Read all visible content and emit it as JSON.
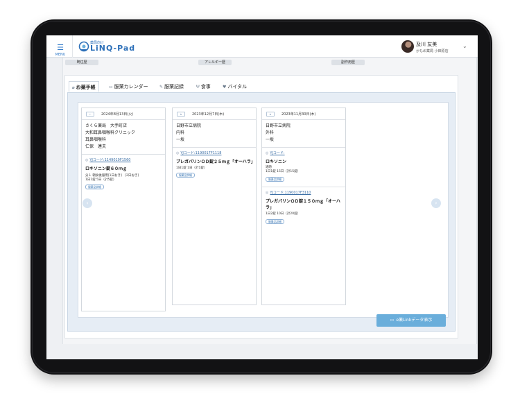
{
  "app": {
    "menu_label": "MENU",
    "logo_sub": "薬局向け",
    "logo_text": "LiNQ-Pad",
    "user_name": "及川 友美",
    "user_store": "かもめ薬局 小田原店",
    "brand_color": "#2c6fb8"
  },
  "history_tabs": [
    "既往歴",
    "アレルギー歴",
    "副作用歴"
  ],
  "tabs": [
    {
      "label": "お薬手帳",
      "icon": "notebook-icon",
      "active": true
    },
    {
      "label": "服薬カレンダー",
      "icon": "calendar-icon",
      "active": false
    },
    {
      "label": "服薬記録",
      "icon": "edit-icon",
      "active": false
    },
    {
      "label": "食事",
      "icon": "fork-knife-icon",
      "active": false
    },
    {
      "label": "バイタル",
      "icon": "vital-icon",
      "active": false
    }
  ],
  "records": [
    {
      "date": "2024年8月13日(火)",
      "info": [
        "さくら薬局　大手町店",
        "大和耳鼻咽喉科クリニック",
        "耳鼻咽喉科",
        "仁保　連夫"
      ],
      "drugs": [
        {
          "yj_code": "YJコード:1149019F1560",
          "name": "ロキソニン錠６０ｍｇ",
          "dose": [
            "分１ 朝食後服用[1日おき]　[2日おき]",
            "1日1錠 5日（計5錠）"
          ],
          "detail": "服薬品詳細"
        }
      ]
    },
    {
      "date": "2023年12月7日(木)",
      "info": [
        "日野市立病院",
        "内科",
        "一坂"
      ],
      "drugs": [
        {
          "yj_code": "YJコード:1190017F1118",
          "name": "プレガバリンＯＤ錠２５ｍｇ「オーハラ」",
          "dose": [
            "1日1錠 1日（計1錠）"
          ],
          "detail": "服薬品詳細"
        }
      ]
    },
    {
      "date": "2023年11月30日(木)",
      "info": [
        "日野市立病院",
        "外科",
        "一坂"
      ],
      "drugs": [
        {
          "yj_code": "YJコード:",
          "name": "ロキソニン",
          "dose": [
            "適時",
            "1日1錠 15日（計15錠）"
          ],
          "detail": "服薬品詳細"
        },
        {
          "yj_code": "YJコード:1190017F3110",
          "name": "プレガバリンＯＤ錠１５０ｍｇ「オーハラ」",
          "dose": [
            "1日2錠 10日（計20錠）"
          ],
          "detail": "服薬品詳細"
        }
      ]
    }
  ],
  "elink_button": "e薬Linkデータ表示",
  "elink_color": "#6aaedb"
}
